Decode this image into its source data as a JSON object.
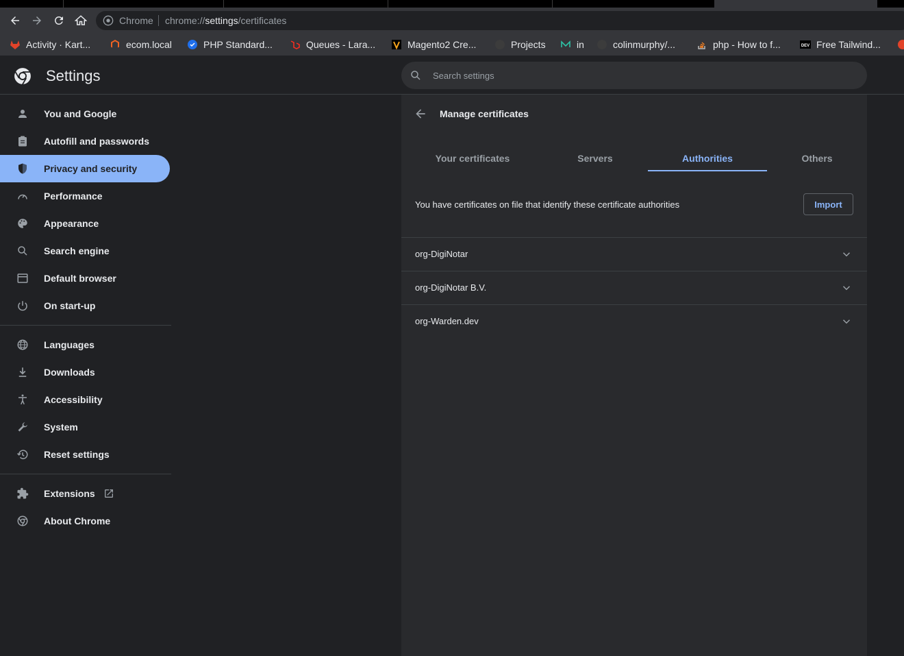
{
  "browser": {
    "omnibox_chip": "Chrome",
    "url_scheme": "chrome://",
    "url_host": "settings",
    "url_path": "/certificates"
  },
  "bookmarks": [
    {
      "label": "Activity · Kart...",
      "icon": "gitlab-icon",
      "color": "#e24329"
    },
    {
      "label": "ecom.local",
      "icon": "magento-icon",
      "color": "#f26322"
    },
    {
      "label": "PHP Standard...",
      "icon": "php-fig-icon",
      "color": "#1f6feb"
    },
    {
      "label": "Queues - Lara...",
      "icon": "laravel-icon",
      "color": "#ff2d20"
    },
    {
      "label": "Magento2 Cre...",
      "icon": "vue-icon",
      "color": "#f7a41d"
    },
    {
      "label": "Projects",
      "icon": "github-icon",
      "color": "#3c3c3c"
    },
    {
      "label": "in",
      "icon": "m-icon",
      "color": "#2dc2a6"
    },
    {
      "label": "colinmurphy/...",
      "icon": "github-icon",
      "color": "#3c3c3c"
    },
    {
      "label": "php - How to f...",
      "icon": "stackoverflow-icon",
      "color": "#f48024"
    },
    {
      "label": "Free Tailwind...",
      "icon": "dev-icon",
      "color": "#ffffff"
    }
  ],
  "header": {
    "title": "Settings",
    "search_placeholder": "Search settings"
  },
  "sidebar": {
    "group1": [
      {
        "label": "You and Google",
        "icon": "person-icon"
      },
      {
        "label": "Autofill and passwords",
        "icon": "clipboard-icon"
      },
      {
        "label": "Privacy and security",
        "icon": "shield-icon",
        "selected": true
      },
      {
        "label": "Performance",
        "icon": "speedometer-icon"
      },
      {
        "label": "Appearance",
        "icon": "palette-icon"
      },
      {
        "label": "Search engine",
        "icon": "search-icon"
      },
      {
        "label": "Default browser",
        "icon": "browser-window-icon"
      },
      {
        "label": "On start-up",
        "icon": "power-icon"
      }
    ],
    "group2": [
      {
        "label": "Languages",
        "icon": "globe-icon"
      },
      {
        "label": "Downloads",
        "icon": "download-icon"
      },
      {
        "label": "Accessibility",
        "icon": "accessibility-icon"
      },
      {
        "label": "System",
        "icon": "wrench-icon"
      },
      {
        "label": "Reset settings",
        "icon": "restore-icon"
      }
    ],
    "group3": [
      {
        "label": "Extensions",
        "icon": "puzzle-icon"
      },
      {
        "label": "About Chrome",
        "icon": "chrome-icon"
      }
    ]
  },
  "certificates": {
    "title": "Manage certificates",
    "tabs": [
      "Your certificates",
      "Servers",
      "Authorities",
      "Others"
    ],
    "active_tab": "Authorities",
    "info": "You have certificates on file that identify these certificate authorities",
    "import_label": "Import",
    "items": [
      "org-DigiNotar",
      "org-DigiNotar B.V.",
      "org-Warden.dev"
    ]
  },
  "colors": {
    "accent": "#8ab4f8",
    "background": "#202124",
    "card": "#292a2d",
    "text": "#e8eaed"
  }
}
